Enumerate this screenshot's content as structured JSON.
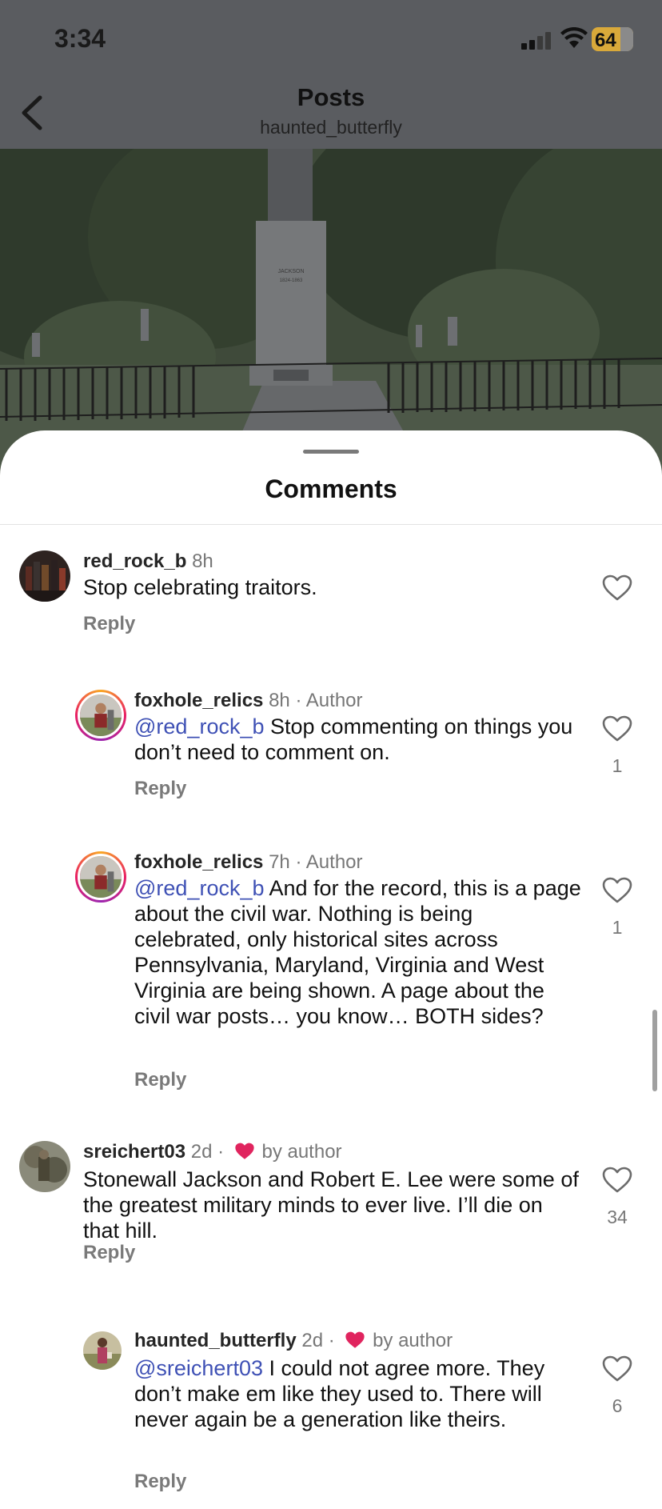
{
  "status_bar": {
    "time": "3:34",
    "battery": "64"
  },
  "header": {
    "title": "Posts",
    "subtitle": "haunted_butterfly"
  },
  "photo": {
    "monument_text": "JACKSON",
    "monument_years": "1824-1863"
  },
  "sheet": {
    "title": "Comments"
  },
  "comments": [
    {
      "user": "red_rock_b",
      "time": "8h",
      "author_tag": "",
      "mention": "",
      "text": "Stop celebrating traitors.",
      "reply": "Reply",
      "likes": ""
    },
    {
      "user": "foxhole_relics",
      "time": "8h",
      "author_tag": "· Author",
      "mention": "@red_rock_b",
      "text": "Stop commenting on things you don’t need to comment on.",
      "reply": "Reply",
      "likes": "1"
    },
    {
      "user": "foxhole_relics",
      "time": "7h",
      "author_tag": "· Author",
      "mention": "@red_rock_b",
      "text": "And for the record, this is a page about the civil war. Nothing is being celebrated, only historical sites across Pennsylvania, Maryland, Virginia and West Virginia are being shown. A page about the civil war posts… you know… BOTH sides?",
      "reply": "Reply",
      "likes": "1"
    },
    {
      "user": "sreichert03",
      "time": "2d ·",
      "liked_by": "by author",
      "mention": "",
      "text": "Stonewall Jackson and Robert E. Lee were some of the greatest military minds to ever live. I’ll die on that hill.",
      "reply": "Reply",
      "likes": "34"
    },
    {
      "user": "haunted_butterfly",
      "time": "2d ·",
      "liked_by": "by author",
      "mention": "@sreichert03",
      "text": "I could not agree more. They don’t make em like they used to. There will never again be a generation like theirs.",
      "reply": "Reply",
      "likes": "6"
    }
  ],
  "colors": {
    "mention": "#3f51b5",
    "heart_liked": "#e0245e",
    "dim_overlay": "#5a5c60"
  }
}
